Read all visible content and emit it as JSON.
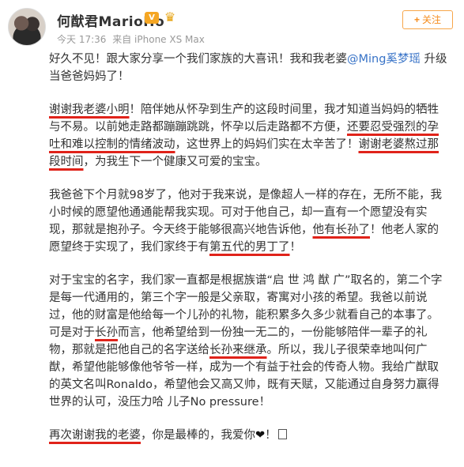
{
  "header": {
    "username": "何猷君MarioHo",
    "vip_badge": "V",
    "member_icon": "crown-icon",
    "time": "今天 17:36",
    "source": "来自 iPhone XS Max",
    "follow_label": "关注",
    "follow_plus": "+"
  },
  "post": {
    "p1": {
      "a": "好久不见！跟大家分享一个我们家族的大喜讯！我和我老婆",
      "mention": "@Ming奚梦瑶",
      "b": " 升级当爸爸妈妈了！"
    },
    "p2": {
      "u1": "谢谢我老婆小明",
      "a": "！陪伴她从怀孕到生产的这段时间里，我才知道当妈妈的牺牲与不易。以前她走路都蹦蹦跳跳，怀孕以后走路都不方便，",
      "u2": "还要忍受强烈的孕吐和难以控制的情绪波动",
      "b": "，这世界上的妈妈们实在太辛苦了！",
      "u3": "谢谢老婆熬过那段时间",
      "c": "，为我生下一个健康又可爱的宝宝。"
    },
    "p3": {
      "a": "我爸爸下个月就98岁了，他对于我来说，是像超人一样的存在，无所不能，我小时候的愿望他通通能帮我实现。可对于他自己，却一直有一个愿望没有实现，那就是抱孙子。今天终于能够很高兴地告诉他，",
      "u1": "他有长孙了",
      "b": "！他老人家的愿望终于实现了，我们家终于有",
      "u2": "第五代的男丁了",
      "c": "！"
    },
    "p4": {
      "a": "对于宝宝的名字，我们家一直都是根据族谱“启 世 鸿 猷 广”取名的，第二个字是每一代通用的，第三个字一般是父亲取，寄寓对小孩的希望。我爸以前说过，他的财富是他给每一个儿孙的礼物，能积累多久多少就看自己的本事了。可是对于",
      "u1": "长孙",
      "b": "而言，他希望给到一份独一无二的，一份能够陪伴一辈子的礼物，那就是把他自己的名字送给",
      "u2": "长孙来继承",
      "c": "。所以，我儿子很荣幸地叫何广猷，希望他能够像他爷爷一样，成为一个有益于社会的传奇人物。我给广猷取的英文名叫Ronaldo，希望他会又高又帅，既有天赋，又能通过自身努力赢得世界的认可，没压力哈 儿子No pressure！"
    },
    "p5": {
      "u1": "再次谢谢我的老婆",
      "a": "，你是最棒的，我爱你",
      "heart": "❤",
      "b": "！"
    }
  }
}
